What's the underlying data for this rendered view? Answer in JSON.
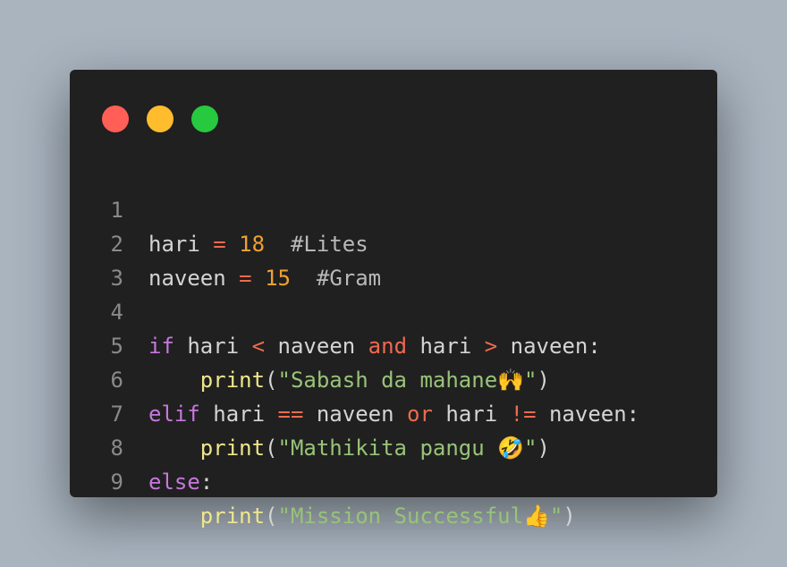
{
  "window": {
    "controls": {
      "close_color": "#ff5f56",
      "minimize_color": "#ffbd2e",
      "maximize_color": "#27c93f"
    }
  },
  "code": {
    "lines": [
      {
        "number": "1",
        "tokens": [
          "hari",
          "=",
          "18",
          "#Lites"
        ]
      },
      {
        "number": "2",
        "tokens": [
          "naveen",
          "=",
          "15",
          "#Gram"
        ]
      },
      {
        "number": "3",
        "tokens": []
      },
      {
        "number": "4",
        "tokens": [
          "if",
          "hari",
          "<",
          "naveen",
          "and",
          "hari",
          ">",
          "naveen:"
        ]
      },
      {
        "number": "5",
        "tokens": [
          "print",
          "(",
          "\"Sabash da mahane🙌\"",
          ")"
        ]
      },
      {
        "number": "6",
        "tokens": [
          "elif",
          "hari",
          "==",
          "naveen",
          "or",
          "hari",
          "!=",
          "naveen:"
        ]
      },
      {
        "number": "7",
        "tokens": [
          "print",
          "(",
          "\"Mathikita pangu 🤣\"",
          ")"
        ]
      },
      {
        "number": "8",
        "tokens": [
          "else",
          ":"
        ]
      },
      {
        "number": "9",
        "tokens": [
          "print",
          "(",
          "\"Mission Successful👍\"",
          ")"
        ]
      }
    ]
  }
}
